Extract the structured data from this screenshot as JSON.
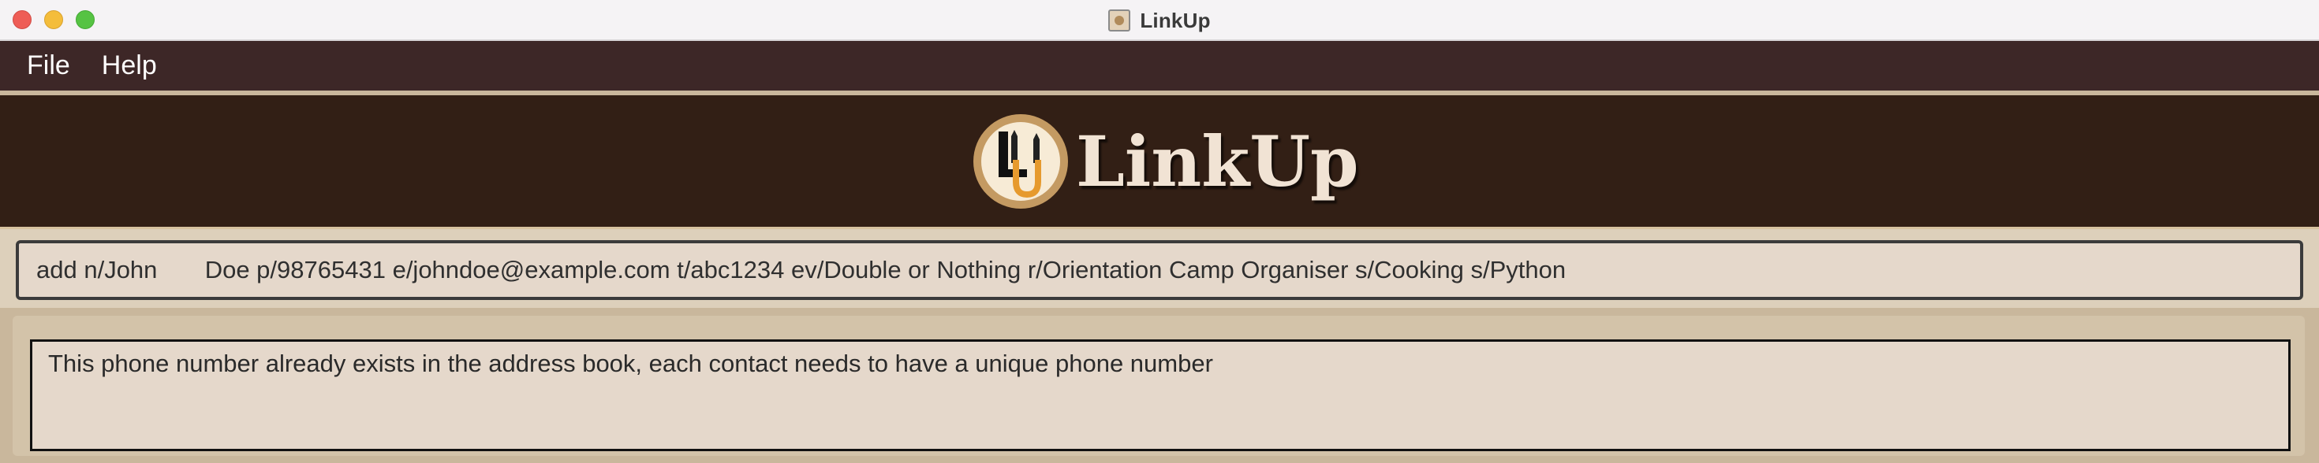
{
  "window": {
    "title": "LinkUp",
    "title_icon": "app-icon"
  },
  "menu": {
    "items": [
      {
        "label": "File"
      },
      {
        "label": "Help"
      }
    ]
  },
  "header": {
    "logo_text": "LinkUp",
    "logo_icon": "linkup-badge-icon",
    "colors": {
      "banner_bg": "#321f15",
      "logo_text": "#f1e3d4",
      "badge_ring": "#c49a62"
    }
  },
  "command": {
    "value": "add n/John       Doe p/98765431 e/johndoe@example.com t/abc1234 ev/Double or Nothing r/Orientation Camp Organiser s/Cooking s/Python"
  },
  "result": {
    "message": "This phone number already exists in the address book, each contact needs to have a unique phone number"
  },
  "theme": {
    "menu_bg": "#3d2727",
    "panel_bg": "#e5d8cb",
    "outer_bg": "#c9b79c"
  }
}
